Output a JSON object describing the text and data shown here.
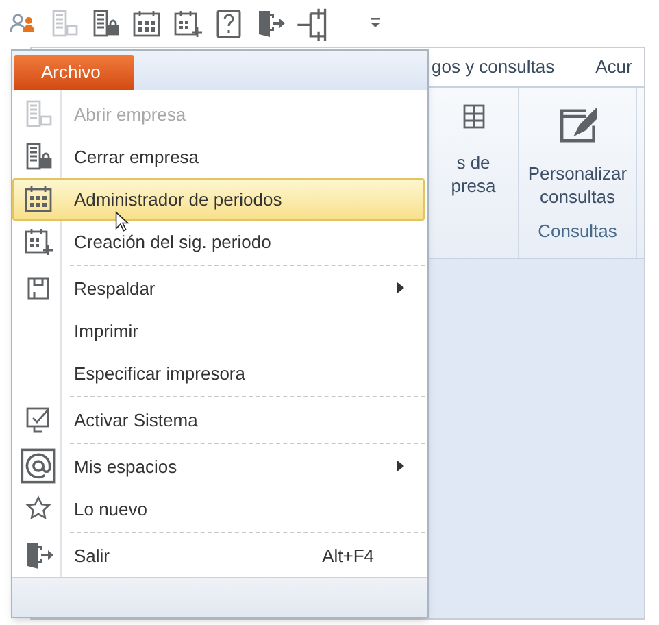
{
  "quick_access": [
    {
      "kind": "users",
      "disabled": false
    },
    {
      "kind": "building",
      "disabled": true
    },
    {
      "kind": "building-lock",
      "disabled": false
    },
    {
      "kind": "calendar",
      "disabled": false
    },
    {
      "kind": "calendar-add",
      "disabled": false
    },
    {
      "kind": "help",
      "disabled": false
    },
    {
      "kind": "exit",
      "disabled": false
    },
    {
      "kind": "network",
      "disabled": false
    },
    {
      "kind": "customize",
      "disabled": false
    }
  ],
  "file_tab": {
    "label": "Archivo"
  },
  "menu": [
    {
      "label": "Abrir empresa",
      "kind": "building",
      "disabled": true,
      "selected": false,
      "separator_before": false
    },
    {
      "label": "Cerrar empresa",
      "kind": "building-lock",
      "disabled": false,
      "selected": false,
      "separator_before": false
    },
    {
      "label": "Administrador de periodos",
      "kind": "calendar",
      "disabled": false,
      "selected": true,
      "separator_before": false
    },
    {
      "label": "Creación del sig. periodo",
      "kind": "calendar-add",
      "disabled": false,
      "selected": false,
      "separator_before": false
    },
    {
      "label": "Respaldar",
      "kind": "save",
      "disabled": false,
      "selected": false,
      "separator_before": true,
      "submenu": true
    },
    {
      "label": "Imprimir",
      "kind": "plain",
      "disabled": false,
      "selected": false,
      "separator_before": false
    },
    {
      "label": "Especificar impresora",
      "kind": "plain",
      "disabled": false,
      "selected": false,
      "separator_before": false
    },
    {
      "label": "Activar Sistema",
      "kind": "check",
      "disabled": false,
      "selected": false,
      "separator_before": true
    },
    {
      "label": "Mis espacios",
      "kind": "at",
      "disabled": false,
      "selected": false,
      "separator_before": true,
      "submenu": true
    },
    {
      "label": "Lo nuevo",
      "kind": "star",
      "disabled": false,
      "selected": false,
      "separator_before": false
    },
    {
      "label": "Salir",
      "kind": "exit",
      "disabled": false,
      "selected": false,
      "separator_before": true,
      "shortcut": "Alt+F4"
    }
  ],
  "ribbon": {
    "tabs": [
      {
        "label": "gos y consultas"
      },
      {
        "label": "Acur"
      }
    ],
    "groups": [
      {
        "buttons": [
          {
            "kind": "grid",
            "lines": [
              "s de",
              "presa"
            ]
          }
        ]
      },
      {
        "buttons": [
          {
            "kind": "edit-window",
            "lines": [
              "Personalizar",
              "consultas"
            ]
          }
        ],
        "label": "Consultas"
      }
    ]
  }
}
